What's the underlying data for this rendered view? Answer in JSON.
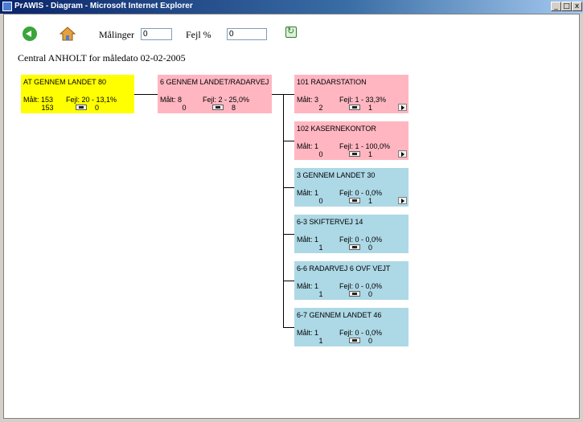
{
  "window": {
    "title": "PrAWIS - Diagram - Microsoft Internet Explorer",
    "minimize": "_",
    "maximize": "□",
    "close": "x"
  },
  "toolbar": {
    "malinger_label": "Målinger",
    "malinger_value": "0",
    "fejl_label": "Fejl %",
    "fejl_value": "0",
    "icons": [
      "back-icon",
      "home-icon",
      "refresh-icon"
    ]
  },
  "heading": "Central ANHOLT for måledato 02-02-2005",
  "nodes": {
    "root": {
      "title": "AT GENNEM LANDET 80",
      "malt": "Målt: 153",
      "fejl": "Fejl: 20 - 13,1%",
      "count": "153",
      "sub": "0"
    },
    "mid": {
      "title": "6 GENNEM LANDET/RADARVEJ",
      "malt": "Målt: 8",
      "fejl": "Fejl: 2 - 25,0%",
      "count": "0",
      "sub": "8"
    },
    "children": [
      {
        "title": "101 RADARSTATION",
        "malt": "Målt: 3",
        "fejl": "Fejl: 1 - 33,3%",
        "count": "2",
        "sub": "1"
      },
      {
        "title": "102 KASERNEKONTOR",
        "malt": "Målt: 1",
        "fejl": "Fejl: 1 - 100,0%",
        "count": "0",
        "sub": "1"
      },
      {
        "title": "3 GENNEM LANDET 30",
        "malt": "Målt: 1",
        "fejl": "Fejl: 0 - 0,0%",
        "count": "0",
        "sub": "1"
      },
      {
        "title": "6-3 SKIFTERVEJ 14",
        "malt": "Målt: 1",
        "fejl": "Fejl: 0 - 0,0%",
        "count": "1",
        "sub": "0"
      },
      {
        "title": "6-6 RADARVEJ 6 OVF VEJT",
        "malt": "Målt: 1",
        "fejl": "Fejl: 0 - 0,0%",
        "count": "1",
        "sub": "0"
      },
      {
        "title": "6-7 GENNEM LANDET 46",
        "malt": "Målt: 1",
        "fejl": "Fejl: 0 - 0,0%",
        "count": "1",
        "sub": "0"
      }
    ]
  },
  "colors": {
    "root": "#ffff00",
    "error": "#ffb6c1",
    "ok": "#add8e6"
  }
}
